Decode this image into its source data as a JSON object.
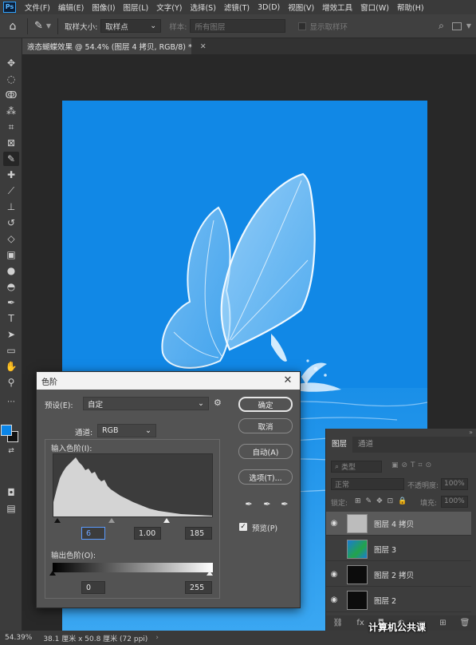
{
  "app": {
    "logo": "Ps"
  },
  "menu": [
    "文件(F)",
    "编辑(E)",
    "图像(I)",
    "图层(L)",
    "文字(Y)",
    "选择(S)",
    "滤镜(T)",
    "3D(D)",
    "视图(V)",
    "增效工具",
    "窗口(W)",
    "帮助(H)"
  ],
  "options_bar": {
    "sample_size_label": "取样大小:",
    "sample_size_value": "取样点",
    "sample_label": "样本:",
    "sample_value": "所有图层",
    "show_ring_label": "显示取样环"
  },
  "document": {
    "tab_title": "液态蝴蝶效果 @ 54.4% (图层 4 拷贝, RGB/8) *",
    "canvas_color": "#1188e6"
  },
  "colors": {
    "foreground": "#0a85e8",
    "background": "#111111"
  },
  "status_bar": {
    "zoom": "54.39%",
    "doc_size": "38.1 厘米 x 50.8 厘米 (72 ppi)"
  },
  "levels_dialog": {
    "title": "色阶",
    "preset_label": "预设(E):",
    "preset_value": "自定",
    "channel_label": "通道:",
    "channel_value": "RGB",
    "input_label": "输入色阶(I):",
    "input_values": {
      "black": "6",
      "gamma": "1.00",
      "white": "185"
    },
    "output_label": "输出色阶(O):",
    "output_values": {
      "black": "0",
      "white": "255"
    },
    "buttons": {
      "ok": "确定",
      "cancel": "取消",
      "auto": "自动(A)",
      "options": "选项(T)..."
    },
    "preview_label": "预览(P)",
    "preview_checked": true
  },
  "layers_panel": {
    "tabs": [
      "图层",
      "通道"
    ],
    "filter_placeholder": "类型",
    "blend_mode": "正常",
    "opacity_label": "不透明度:",
    "opacity_value": "100%",
    "lock_label": "锁定:",
    "fill_label": "填充:",
    "fill_value": "100%",
    "layers": [
      {
        "name": "图层 4 拷贝",
        "active": true,
        "visible": true
      },
      {
        "name": "图层 3",
        "active": false,
        "visible": false
      },
      {
        "name": "图层 2 拷贝",
        "active": false,
        "visible": true
      },
      {
        "name": "图层 2",
        "active": false,
        "visible": true
      }
    ]
  },
  "watermark": "计算机公共课"
}
